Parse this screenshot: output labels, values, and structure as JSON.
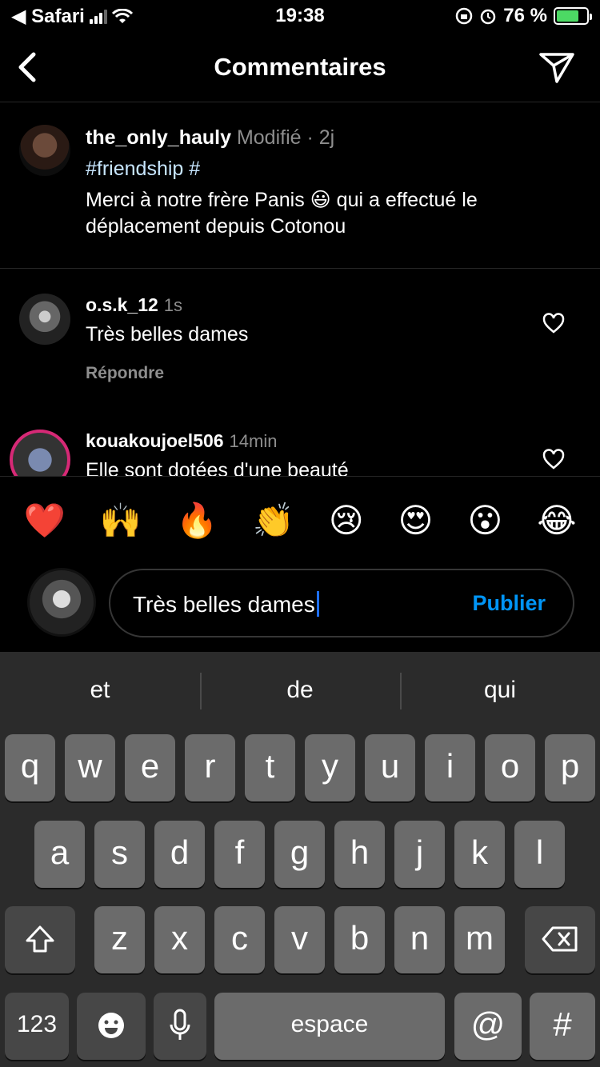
{
  "status_bar": {
    "carrier": "◀ Safari",
    "time": "19:38",
    "battery_percent": "76 %",
    "battery_level": 0.76
  },
  "header": {
    "title": "Commentaires",
    "back_icon": "chevron-left-icon",
    "send_icon": "paper-plane-icon"
  },
  "caption": {
    "username": "the_only_hauly",
    "meta": "Modifié · 2j",
    "hashtags": "#friendship #",
    "text": "Merci à notre frère Panis 😃 qui a effectué le déplacement depuis Cotonou"
  },
  "comments": [
    {
      "username": "o.s.k_12",
      "time": "1s",
      "text": "Très belles dames",
      "reply_label": "Répondre"
    },
    {
      "username": "kouakoujoel506",
      "time": "14min",
      "text": "Elle sont dotées d'une beauté"
    }
  ],
  "emoji_bar": [
    "❤️",
    "🙌",
    "🔥",
    "👏",
    "😢",
    "😍",
    "😮",
    "😂"
  ],
  "composer": {
    "value": "Très belles dames",
    "publish_label": "Publier"
  },
  "keyboard": {
    "suggestions": [
      "et",
      "de",
      "qui"
    ],
    "row1": [
      "q",
      "w",
      "e",
      "r",
      "t",
      "y",
      "u",
      "i",
      "o",
      "p"
    ],
    "row2": [
      "a",
      "s",
      "d",
      "f",
      "g",
      "h",
      "j",
      "k",
      "l"
    ],
    "row3": [
      "z",
      "x",
      "c",
      "v",
      "b",
      "n",
      "m"
    ],
    "numbers_label": "123",
    "space_label": "espace",
    "at_label": "@",
    "hash_label": "#"
  }
}
